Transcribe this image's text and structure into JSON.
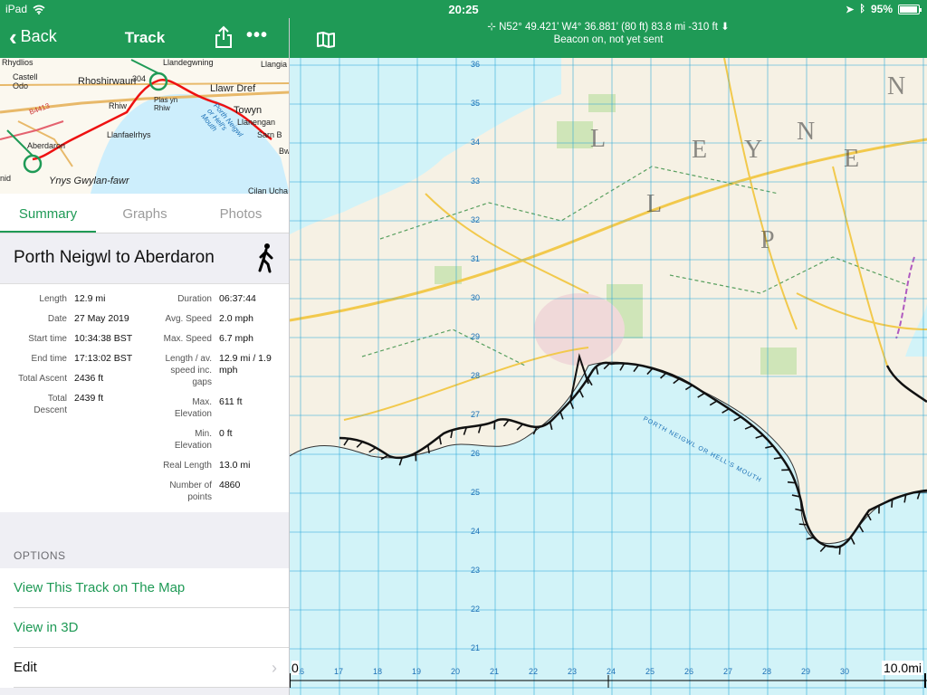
{
  "status": {
    "device": "iPad",
    "time": "20:25",
    "battery": "95%"
  },
  "nav": {
    "back_label": "Back",
    "title": "Track"
  },
  "minimap": {
    "labels": [
      "Rhydlios",
      "Llandegwning",
      "Llangia",
      "Castell Odo",
      "Rhoshirwaun",
      "304",
      "Llawr Dref",
      "Rhiw",
      "Plas yn Rhiw",
      "Towyn",
      "Llanengan",
      "Sarn B",
      "Llanfaelrhys",
      "Porth Neigwl or Hell's Mouth",
      "B4413",
      "Aberdaron",
      "Ynys Gwylan-fawr",
      "Cilan Ucha",
      "nid",
      "Bw"
    ]
  },
  "tabs": [
    "Summary",
    "Graphs",
    "Photos"
  ],
  "track": {
    "name": "Porth Neigwl to Aberdaron"
  },
  "stats": {
    "left": [
      {
        "label": "Length",
        "value": "12.9 mi"
      },
      {
        "label": "Date",
        "value": "27 May 2019"
      },
      {
        "label": "Start time",
        "value": "10:34:38 BST"
      },
      {
        "label": "End time",
        "value": "17:13:02 BST"
      },
      {
        "label": "Total Ascent",
        "value": "2436 ft"
      },
      {
        "label": "Total Descent",
        "value": "2439 ft"
      }
    ],
    "right": [
      {
        "label": "Duration",
        "value": "06:37:44"
      },
      {
        "label": "Avg. Speed",
        "value": "2.0 mph"
      },
      {
        "label": "Max. Speed",
        "value": "6.7 mph"
      },
      {
        "label": "Length / av. speed inc. gaps",
        "value": "12.9 mi / 1.9 mph"
      },
      {
        "label": "Max. Elevation",
        "value": "611 ft"
      },
      {
        "label": "Min. Elevation",
        "value": "0 ft"
      },
      {
        "label": "Real Length",
        "value": "13.0 mi"
      },
      {
        "label": "Number of points",
        "value": "4860"
      }
    ]
  },
  "options": {
    "title": "OPTIONS",
    "items": [
      "View This Track on The Map",
      "View in 3D",
      "Edit"
    ]
  },
  "map_header": {
    "coords": "⊹ N52° 49.421' W4° 36.881' (80 ft)     83.8 mi     -310 ft ⬇",
    "beacon": "Beacon on, not yet sent"
  },
  "map": {
    "scale_start": "0",
    "scale_end": "10.0mi",
    "x_ticks": [
      "16",
      "17",
      "18",
      "19",
      "20",
      "21",
      "22",
      "23",
      "24",
      "25",
      "26",
      "27",
      "28",
      "29",
      "30"
    ],
    "y_ticks": [
      "36",
      "35",
      "34",
      "33",
      "32",
      "31",
      "30",
      "29",
      "28",
      "27",
      "26",
      "25",
      "24",
      "23",
      "22",
      "21"
    ],
    "sea_label": "PORTH NEIGWL OR HELL'S MOUTH",
    "region_letters": [
      "L",
      "L",
      "E",
      "Y",
      "N",
      "P",
      "E",
      "N"
    ]
  },
  "colors": {
    "accent": "#1f9a56",
    "sea": "#d2f3f8",
    "grid": "#2aa6d8",
    "track": "#111111"
  }
}
